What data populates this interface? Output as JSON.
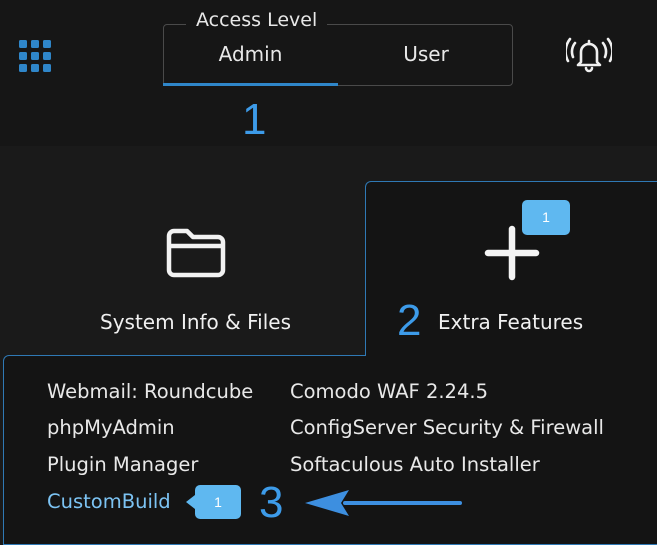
{
  "access": {
    "legend": "Access Level",
    "tabs": [
      {
        "label": "Admin",
        "active": true
      },
      {
        "label": "User",
        "active": false
      }
    ]
  },
  "steps": [
    "1",
    "2",
    "3"
  ],
  "cards": {
    "system": {
      "label": "System Info & Files",
      "icon": "folder-icon"
    },
    "extra": {
      "label": "Extra Features",
      "icon": "plus-icon",
      "badge": "1"
    }
  },
  "menu": {
    "col1": [
      "Webmail: Roundcube",
      "phpMyAdmin",
      "Plugin Manager",
      "CustomBuild"
    ],
    "col2": [
      "Comodo WAF 2.24.5",
      "ConfigServer Security & Firewall",
      "Softaculous Auto Installer"
    ],
    "custombuild_badge": "1"
  },
  "colors": {
    "accent": "#2f86c9",
    "badge": "#5fb8f0",
    "step": "#3d9be9",
    "highlight_link": "#7cc3f3"
  },
  "icons": [
    "apps-grid-icon",
    "bell-ringing-icon",
    "folder-icon",
    "plus-icon",
    "arrow-left-icon"
  ]
}
